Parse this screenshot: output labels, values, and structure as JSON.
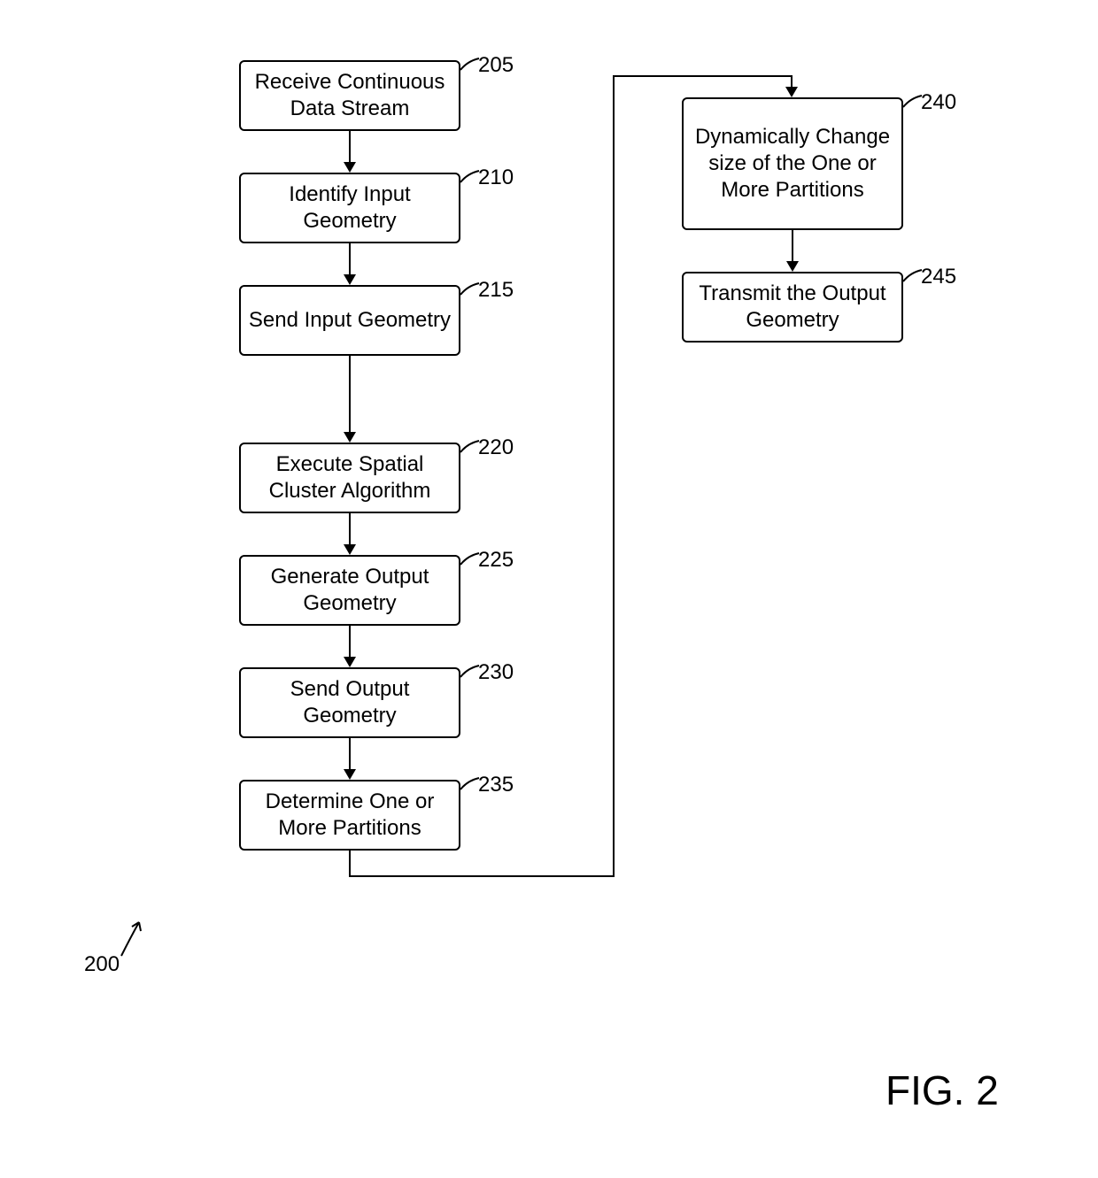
{
  "figure_ref": "200",
  "figure_caption": "FIG. 2",
  "boxes": {
    "b205": {
      "text": "Receive Continuous Data Stream",
      "label": "205"
    },
    "b210": {
      "text": "Identify Input Geometry",
      "label": "210"
    },
    "b215": {
      "text": "Send Input Geometry",
      "label": "215"
    },
    "b220": {
      "text": "Execute Spatial Cluster Algorithm",
      "label": "220"
    },
    "b225": {
      "text": "Generate Output Geometry",
      "label": "225"
    },
    "b230": {
      "text": "Send Output Geometry",
      "label": "230"
    },
    "b235": {
      "text": "Determine One or More Partitions",
      "label": "235"
    },
    "b240": {
      "text": "Dynamically Change size of the One or More Partitions",
      "label": "240"
    },
    "b245": {
      "text": "Transmit the Output Geometry",
      "label": "245"
    }
  }
}
